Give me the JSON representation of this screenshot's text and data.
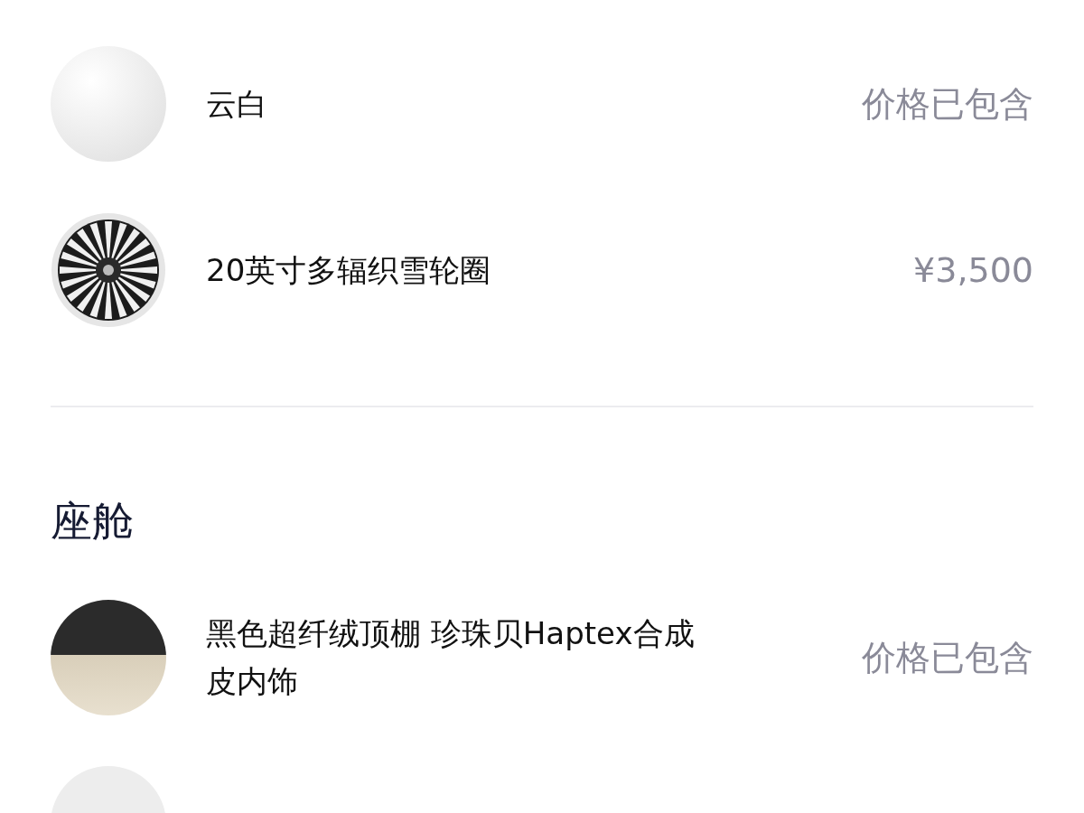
{
  "exterior": {
    "items": [
      {
        "kind": "paint",
        "name": "云白",
        "price": "价格已包含"
      },
      {
        "kind": "wheel",
        "name": "20英寸多辐织雪轮圈",
        "price": "¥3,500"
      }
    ]
  },
  "cabin": {
    "title": "座舱",
    "items": [
      {
        "kind": "upholstery",
        "name": "黑色超纤绒顶棚 珍珠贝Haptex合成皮内饰",
        "price": "价格已包含"
      }
    ]
  }
}
